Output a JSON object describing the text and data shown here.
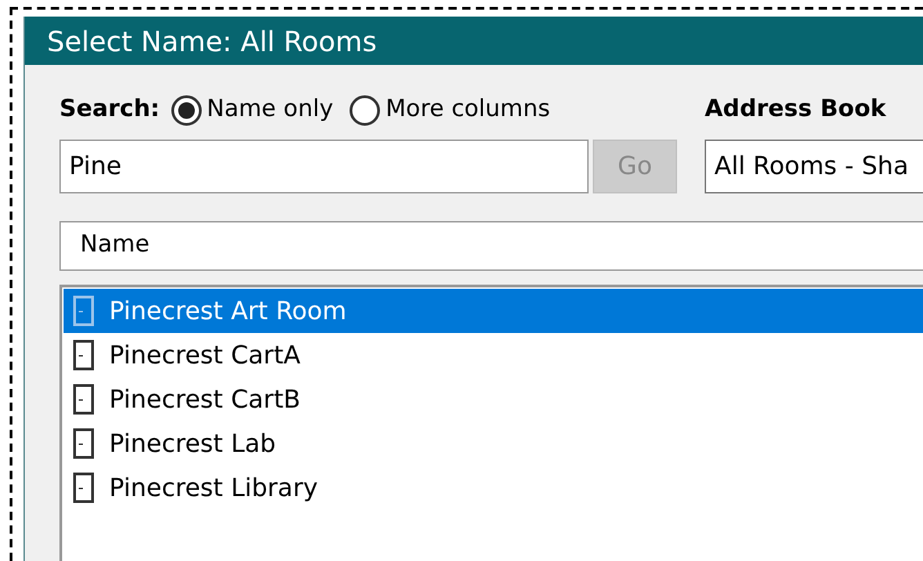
{
  "window": {
    "title": "Select Name: All Rooms"
  },
  "search": {
    "label": "Search:",
    "options": [
      {
        "label": "Name only",
        "selected": true
      },
      {
        "label": "More columns",
        "selected": false
      }
    ],
    "value": "Pine",
    "go_button": {
      "label": "Go",
      "disabled": true
    }
  },
  "address_book": {
    "label": "Address Book",
    "value": "All Rooms - Sha"
  },
  "table": {
    "columns": [
      "Name"
    ],
    "rows": [
      {
        "name": "Pinecrest Art Room",
        "selected": true
      },
      {
        "name": "Pinecrest CartA",
        "selected": false
      },
      {
        "name": "Pinecrest CartB",
        "selected": false
      },
      {
        "name": "Pinecrest Lab",
        "selected": false
      },
      {
        "name": "Pinecrest Library",
        "selected": false
      }
    ]
  }
}
